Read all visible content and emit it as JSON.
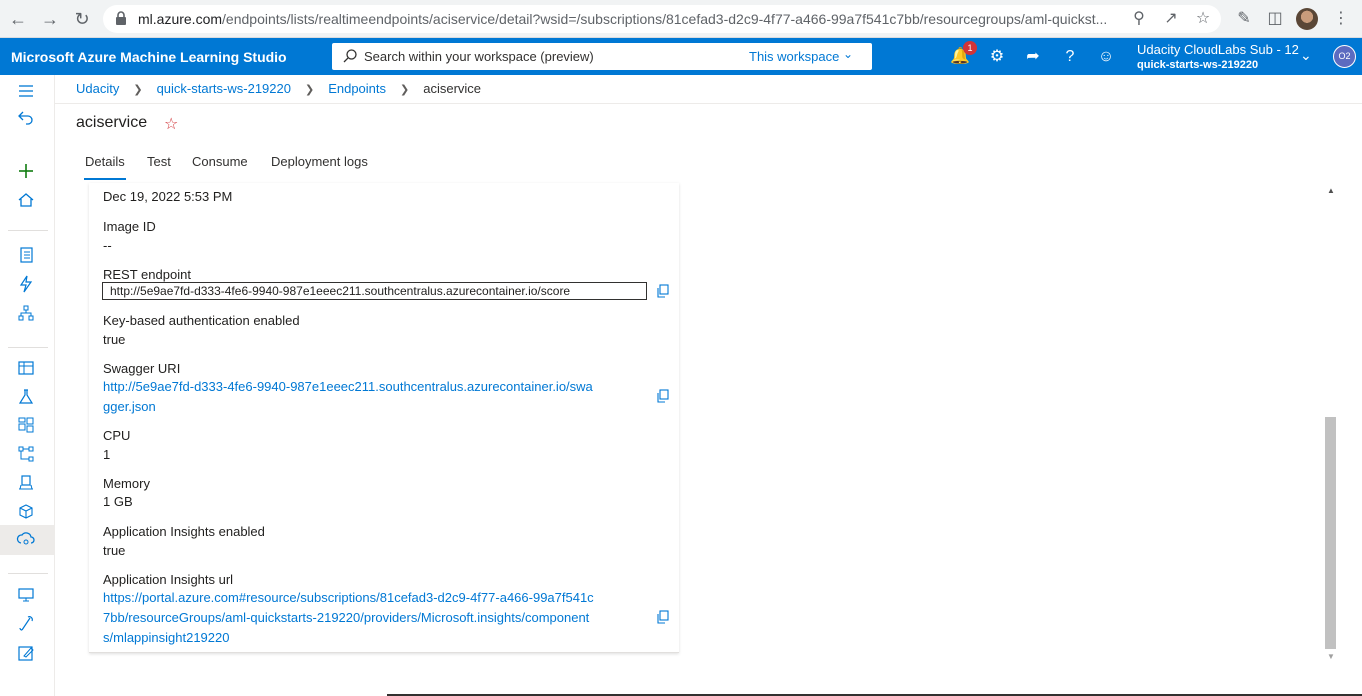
{
  "browser": {
    "url_host": "ml.azure.com",
    "url_path": "/endpoints/lists/realtimeendpoints/aciservice/detail?wsid=/subscriptions/81cefad3-d2c9-4f77-a466-99a7f541c7bb/resourcegroups/aml-quickst..."
  },
  "header": {
    "brand": "Microsoft Azure Machine Learning Studio",
    "search_placeholder": "Search within your workspace (preview)",
    "search_scope": "This workspace",
    "notification_count": "1",
    "account_line1": "Udacity CloudLabs Sub - 12",
    "account_line2": "quick-starts-ws-219220",
    "avatar_initials": "O2"
  },
  "breadcrumb": {
    "items": [
      "Udacity",
      "quick-starts-ws-219220",
      "Endpoints"
    ],
    "current": "aciservice"
  },
  "page": {
    "title": "aciservice"
  },
  "tabs": [
    "Details",
    "Test",
    "Consume",
    "Deployment logs"
  ],
  "details": {
    "date_value": "Dec 19, 2022 5:53 PM",
    "image_id_label": "Image ID",
    "image_id_value": "--",
    "rest_label": "REST endpoint",
    "rest_value": "http://5e9ae7fd-d333-4fe6-9940-987e1eeec211.southcentralus.azurecontainer.io/score",
    "keyauth_label": "Key-based authentication enabled",
    "keyauth_value": "true",
    "swagger_label": "Swagger URI",
    "swagger_line1": "http://5e9ae7fd-d333-4fe6-9940-987e1eeec211.southcentralus.azurecontainer.io/swa",
    "swagger_line2": "gger.json",
    "cpu_label": "CPU",
    "cpu_value": "1",
    "memory_label": "Memory",
    "memory_value": "1 GB",
    "appins_label": "Application Insights enabled",
    "appins_value": "true",
    "appins_url_label": "Application Insights url",
    "appins_url_line1": "https://portal.azure.com#resource/subscriptions/81cefad3-d2c9-4f77-a466-99a7f541c",
    "appins_url_line2": "7bb/resourceGroups/aml-quickstarts-219220/providers/Microsoft.insights/component",
    "appins_url_line3": "s/mlappinsight219220"
  },
  "colors": {
    "azure_blue": "#0078d4",
    "badge_red": "#d13438"
  }
}
